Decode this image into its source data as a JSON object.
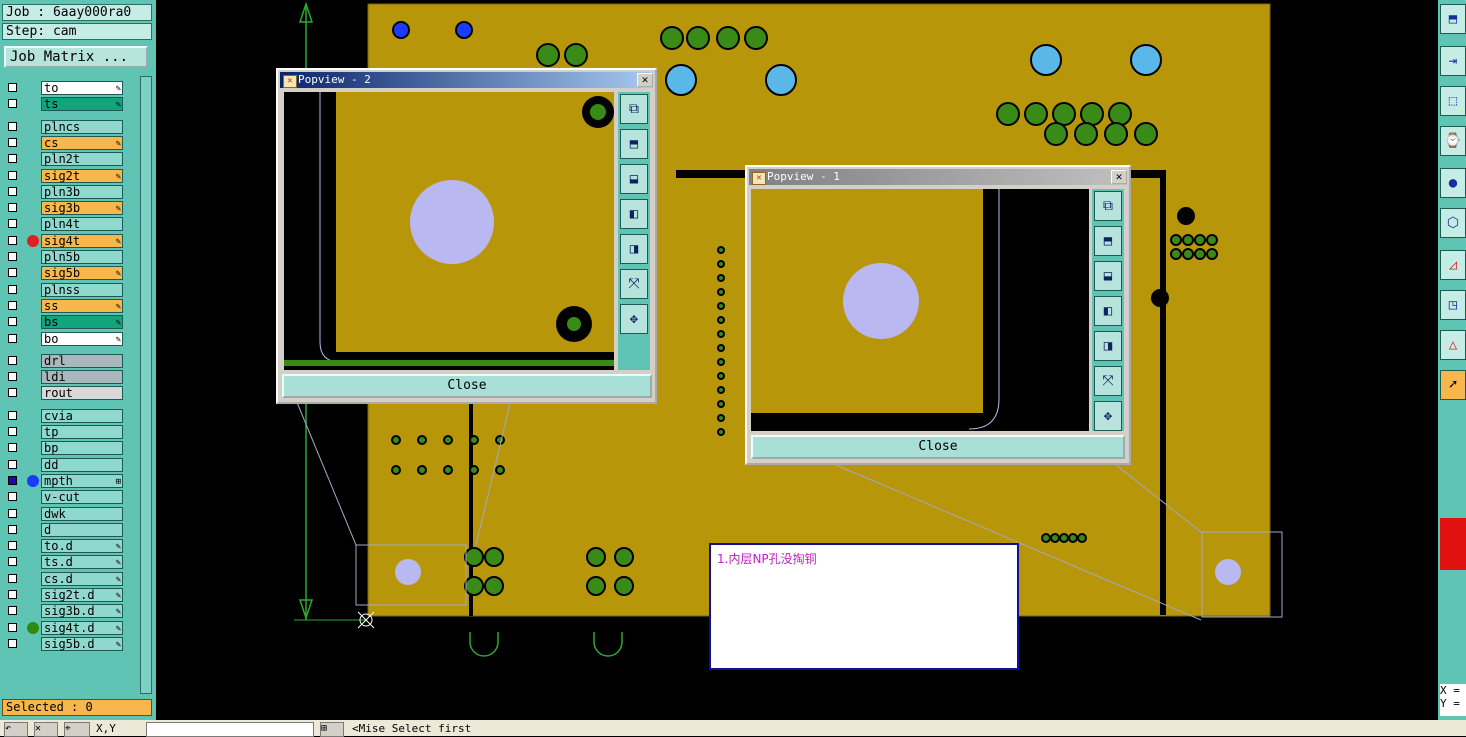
{
  "job_label": "Job : 6aay000ra0",
  "step_label": "Step: cam",
  "job_matrix_button": "Job Matrix ...",
  "layers": [
    {
      "name": "to",
      "color": "#ffffff",
      "mark": "✎",
      "dot": ""
    },
    {
      "name": "ts",
      "color": "#12a47a",
      "mark": "✎",
      "dot": ""
    },
    {
      "name": "plncs",
      "color": "#8fd8ce",
      "mark": "",
      "dot": ""
    },
    {
      "name": "cs",
      "color": "#f7b74c",
      "mark": "✎",
      "dot": ""
    },
    {
      "name": "pln2t",
      "color": "#8fd8ce",
      "mark": "",
      "dot": ""
    },
    {
      "name": "sig2t",
      "color": "#f7b74c",
      "mark": "✎",
      "dot": ""
    },
    {
      "name": "pln3b",
      "color": "#8fd8ce",
      "mark": "",
      "dot": ""
    },
    {
      "name": "sig3b",
      "color": "#f7b74c",
      "mark": "✎",
      "dot": ""
    },
    {
      "name": "pln4t",
      "color": "#8fd8ce",
      "mark": "",
      "dot": ""
    },
    {
      "name": "sig4t",
      "color": "#f7b74c",
      "mark": "✎",
      "dot": "#e02020"
    },
    {
      "name": "pln5b",
      "color": "#8fd8ce",
      "mark": "",
      "dot": ""
    },
    {
      "name": "sig5b",
      "color": "#f7b74c",
      "mark": "✎",
      "dot": ""
    },
    {
      "name": "plnss",
      "color": "#8fd8ce",
      "mark": "",
      "dot": ""
    },
    {
      "name": "ss",
      "color": "#f7b74c",
      "mark": "✎",
      "dot": ""
    },
    {
      "name": "bs",
      "color": "#12a47a",
      "mark": "✎",
      "dot": ""
    },
    {
      "name": "bo",
      "color": "#ffffff",
      "mark": "✎",
      "dot": ""
    },
    {
      "name": "drl",
      "color": "#a8b8bc",
      "mark": "",
      "dot": ""
    },
    {
      "name": "ldi",
      "color": "#a8b8bc",
      "mark": "",
      "dot": ""
    },
    {
      "name": "rout",
      "color": "#d8d8d8",
      "mark": "",
      "dot": ""
    },
    {
      "name": "cvia",
      "color": "#8fd8ce",
      "mark": "",
      "dot": ""
    },
    {
      "name": "tp",
      "color": "#8fd8ce",
      "mark": "",
      "dot": ""
    },
    {
      "name": "bp",
      "color": "#8fd8ce",
      "mark": "",
      "dot": ""
    },
    {
      "name": "dd",
      "color": "#8fd8ce",
      "mark": "",
      "dot": ""
    },
    {
      "name": "mpth",
      "color": "#8fd8ce",
      "mark": "⊞",
      "dot": "#1a3cff"
    },
    {
      "name": "v-cut",
      "color": "#8fd8ce",
      "mark": "",
      "dot": ""
    },
    {
      "name": "dwk",
      "color": "#8fd8ce",
      "mark": "",
      "dot": ""
    },
    {
      "name": "d",
      "color": "#8fd8ce",
      "mark": "",
      "dot": ""
    },
    {
      "name": "to.d",
      "color": "#8fd8ce",
      "mark": "✎",
      "dot": ""
    },
    {
      "name": "ts.d",
      "color": "#8fd8ce",
      "mark": "✎",
      "dot": ""
    },
    {
      "name": "cs.d",
      "color": "#8fd8ce",
      "mark": "✎",
      "dot": ""
    },
    {
      "name": "sig2t.d",
      "color": "#8fd8ce",
      "mark": "✎",
      "dot": ""
    },
    {
      "name": "sig3b.d",
      "color": "#8fd8ce",
      "mark": "✎",
      "dot": ""
    },
    {
      "name": "sig4t.d",
      "color": "#8fd8ce",
      "mark": "✎",
      "dot": "#2e8b10"
    },
    {
      "name": "sig5b.d",
      "color": "#8fd8ce",
      "mark": "✎",
      "dot": ""
    }
  ],
  "selected_label": "Selected : 0",
  "popview2": {
    "title": "Popview - 2",
    "close": "Close"
  },
  "popview1": {
    "title": "Popview - 1",
    "close": "Close"
  },
  "message": "1.内层NP孔没掏铜",
  "coords": {
    "x": "X =",
    "y": "Y ="
  },
  "status_text": "<Mise Select first",
  "xy_label": "X,Y",
  "colors": {
    "board": "#b8960a",
    "pad_green": "#3a8a18",
    "hole_blue": "#5ab8e8",
    "drill_lavender": "#bab8f0",
    "panel": "#5fc4b4"
  }
}
